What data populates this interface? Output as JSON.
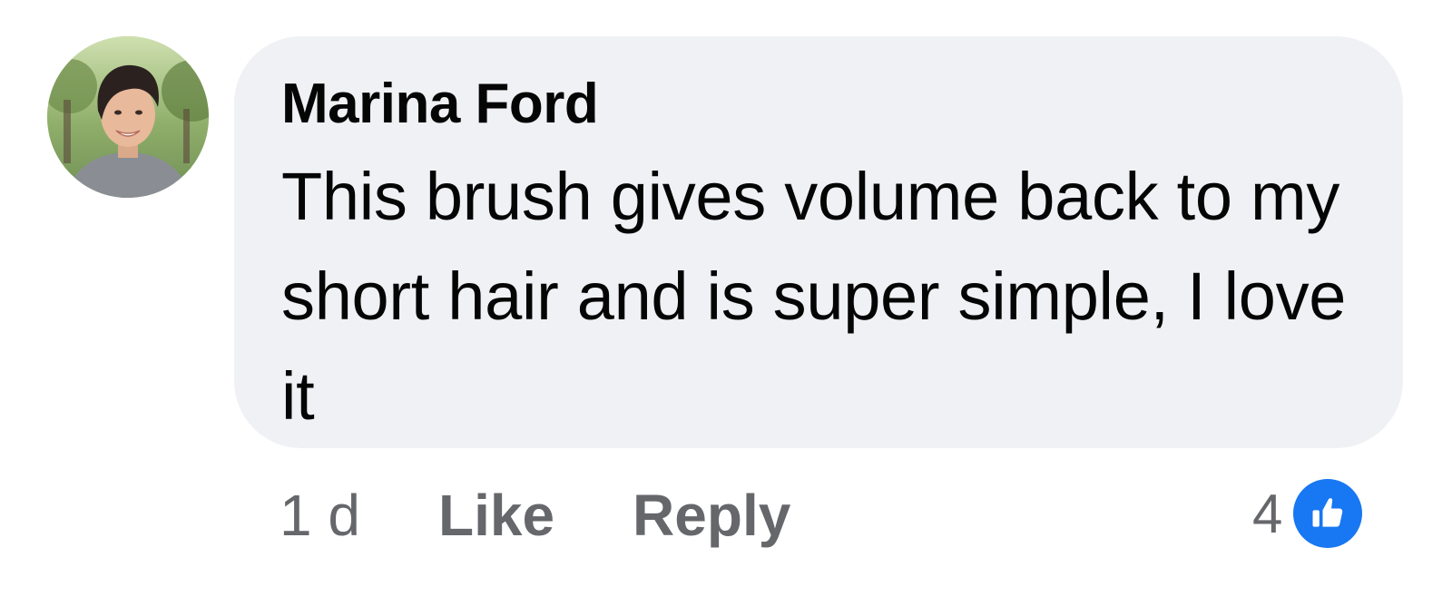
{
  "comment": {
    "author": "Marina Ford",
    "text": "This brush gives volume back to my short hair and is super simple, I love it",
    "timestamp": "1 d",
    "like_label": "Like",
    "reply_label": "Reply",
    "reaction_count": "4",
    "reaction_type": "like-icon"
  },
  "colors": {
    "bubble": "#f0f1f5",
    "meta_text": "#65676b",
    "like_blue": "#1877f2"
  }
}
